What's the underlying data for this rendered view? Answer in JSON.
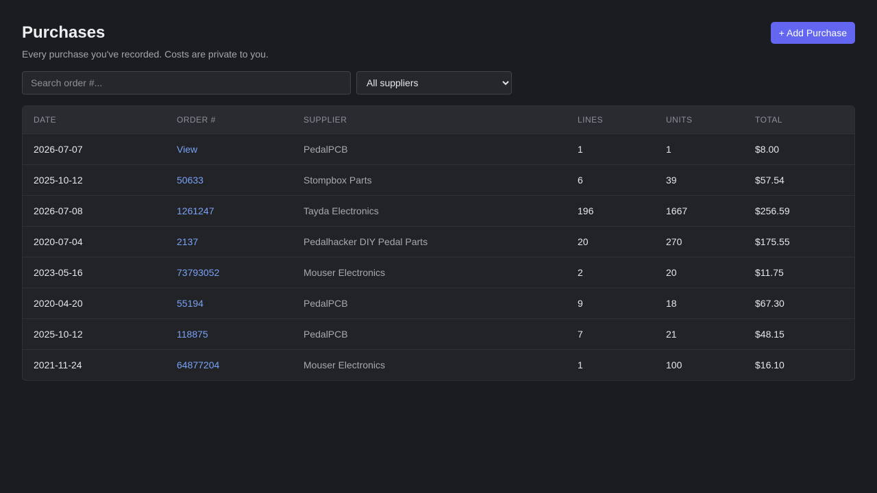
{
  "header": {
    "title": "Purchases",
    "subtitle": "Every purchase you've recorded. Costs are private to you.",
    "add_button_label": "+ Add Purchase"
  },
  "filters": {
    "search_placeholder": "Search order #...",
    "supplier_select_value": "All suppliers"
  },
  "table": {
    "columns": [
      "DATE",
      "ORDER #",
      "SUPPLIER",
      "LINES",
      "UNITS",
      "TOTAL"
    ],
    "rows": [
      {
        "date": "2026-07-07",
        "order": "View",
        "supplier": "PedalPCB",
        "lines": "1",
        "units": "1",
        "total": "$8.00"
      },
      {
        "date": "2025-10-12",
        "order": "50633",
        "supplier": "Stompbox Parts",
        "lines": "6",
        "units": "39",
        "total": "$57.54"
      },
      {
        "date": "2026-07-08",
        "order": "1261247",
        "supplier": "Tayda Electronics",
        "lines": "196",
        "units": "1667",
        "total": "$256.59"
      },
      {
        "date": "2020-07-04",
        "order": "2137",
        "supplier": "Pedalhacker DIY Pedal Parts",
        "lines": "20",
        "units": "270",
        "total": "$175.55"
      },
      {
        "date": "2023-05-16",
        "order": "73793052",
        "supplier": "Mouser Electronics",
        "lines": "2",
        "units": "20",
        "total": "$11.75"
      },
      {
        "date": "2020-04-20",
        "order": "55194",
        "supplier": "PedalPCB",
        "lines": "9",
        "units": "18",
        "total": "$67.30"
      },
      {
        "date": "2025-10-12",
        "order": "118875",
        "supplier": "PedalPCB",
        "lines": "7",
        "units": "21",
        "total": "$48.15"
      },
      {
        "date": "2021-11-24",
        "order": "64877204",
        "supplier": "Mouser Electronics",
        "lines": "1",
        "units": "100",
        "total": "$16.10"
      }
    ]
  },
  "colors": {
    "background": "#1b1c1f",
    "accent": "#6366f1",
    "link": "#7aa2f7"
  }
}
